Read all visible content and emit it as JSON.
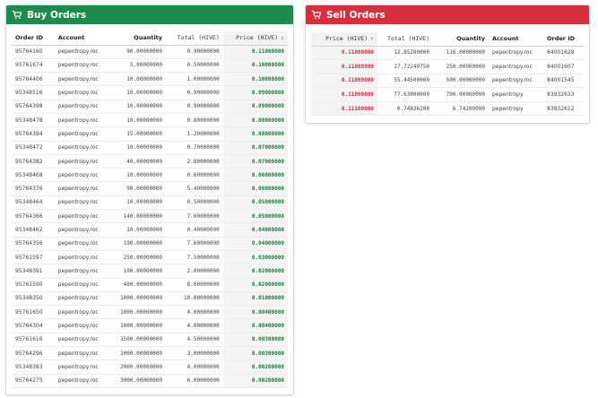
{
  "colors": {
    "buy_header": "#1e8a4c",
    "sell_header": "#d6303f",
    "buy_price": "#1e7a3c",
    "sell_price": "#d12a3a"
  },
  "buy": {
    "title": "Buy Orders",
    "icon": "cart-icon",
    "columns": {
      "order_id": "Order ID",
      "account": "Account",
      "quantity": "Quantity",
      "total": "Total (HIVE)",
      "price": "Price (HIVE)",
      "sort_indicator": "↓"
    },
    "rows": [
      {
        "order_id": "95764160",
        "account": "pepentropy.roc",
        "quantity": "90.00000000",
        "total": "9.90000000",
        "price": "0.11000000"
      },
      {
        "order_id": "95761674",
        "account": "pepentropy.roc",
        "quantity": "5.00000000",
        "total": "0.50000000",
        "price": "0.10000000"
      },
      {
        "order_id": "95764406",
        "account": "pepentropy.roc",
        "quantity": "10.00000000",
        "total": "1.00000000",
        "price": "0.10000000"
      },
      {
        "order_id": "95348516",
        "account": "pepentropy.roc",
        "quantity": "10.00000000",
        "total": "0.90000000",
        "price": "0.09000000"
      },
      {
        "order_id": "95764398",
        "account": "pepentropy.roc",
        "quantity": "10.00000000",
        "total": "0.90000000",
        "price": "0.09000000"
      },
      {
        "order_id": "95348478",
        "account": "pepentropy.roc",
        "quantity": "10.00000000",
        "total": "0.80000000",
        "price": "0.08000000"
      },
      {
        "order_id": "95764394",
        "account": "pepentropy.roc",
        "quantity": "15.00000000",
        "total": "1.20000000",
        "price": "0.08000000"
      },
      {
        "order_id": "95348472",
        "account": "pepentropy.roc",
        "quantity": "10.00000000",
        "total": "0.70000000",
        "price": "0.07000000"
      },
      {
        "order_id": "95764382",
        "account": "pepentropy.roc",
        "quantity": "40.00000000",
        "total": "2.80000000",
        "price": "0.07000000"
      },
      {
        "order_id": "95348468",
        "account": "pepentropy.roc",
        "quantity": "10.00000000",
        "total": "0.60000000",
        "price": "0.06000000"
      },
      {
        "order_id": "95764376",
        "account": "pepentropy.roc",
        "quantity": "90.00000000",
        "total": "5.40000000",
        "price": "0.06000000"
      },
      {
        "order_id": "95348464",
        "account": "pepentropy.roc",
        "quantity": "10.00000000",
        "total": "0.50000000",
        "price": "0.05000000"
      },
      {
        "order_id": "95764366",
        "account": "pepentropy.roc",
        "quantity": "140.00000000",
        "total": "7.00000000",
        "price": "0.05000000"
      },
      {
        "order_id": "95348462",
        "account": "pepentropy.roc",
        "quantity": "10.00000000",
        "total": "0.40000000",
        "price": "0.04000000"
      },
      {
        "order_id": "95764356",
        "account": "pepentropy.roc",
        "quantity": "190.00000000",
        "total": "7.60000000",
        "price": "0.04000000"
      },
      {
        "order_id": "95761597",
        "account": "pepentropy.roc",
        "quantity": "250.00000000",
        "total": "7.50000000",
        "price": "0.03000000"
      },
      {
        "order_id": "95348391",
        "account": "pepentropy.roc",
        "quantity": "100.00000000",
        "total": "2.00000000",
        "price": "0.02000000"
      },
      {
        "order_id": "95761590",
        "account": "pepentropy.roc",
        "quantity": "400.00000000",
        "total": "8.00000000",
        "price": "0.02000000"
      },
      {
        "order_id": "95348350",
        "account": "pepentropy.roc",
        "quantity": "1000.00000000",
        "total": "10.00000000",
        "price": "0.01000000"
      },
      {
        "order_id": "95761650",
        "account": "pepentropy.roc",
        "quantity": "1000.00000000",
        "total": "4.00000000",
        "price": "0.00400000"
      },
      {
        "order_id": "95764304",
        "account": "pepentropy.roc",
        "quantity": "1000.00000000",
        "total": "4.00000000",
        "price": "0.00400000"
      },
      {
        "order_id": "95761616",
        "account": "pepentropy.roc",
        "quantity": "1500.00000000",
        "total": "4.50000000",
        "price": "0.00300000"
      },
      {
        "order_id": "95764296",
        "account": "pepentropy.roc",
        "quantity": "1000.00000000",
        "total": "3.00000000",
        "price": "0.00300000"
      },
      {
        "order_id": "95348383",
        "account": "pepentropy.roc",
        "quantity": "2000.00000000",
        "total": "4.00000000",
        "price": "0.00200000"
      },
      {
        "order_id": "95764275",
        "account": "pepentropy.roc",
        "quantity": "3000.00000000",
        "total": "6.00000000",
        "price": "0.00200000"
      }
    ]
  },
  "sell": {
    "title": "Sell Orders",
    "icon": "cart-icon",
    "columns": {
      "price": "Price (HIVE)",
      "sort_indicator": "↑",
      "total": "Total (HIVE)",
      "quantity": "Quantity",
      "account": "Account",
      "order_id": "Order ID"
    },
    "rows": [
      {
        "price": "0.11080000",
        "total": "12.85280000",
        "quantity": "116.00000000",
        "account": "pepentropy.roc",
        "order_id": "84001628"
      },
      {
        "price": "0.11088999",
        "total": "27.72249750",
        "quantity": "250.00000000",
        "account": "pepentropy.roc",
        "order_id": "84001607"
      },
      {
        "price": "0.11089000",
        "total": "55.44500000",
        "quantity": "500.00000000",
        "account": "pepentropy.roc",
        "order_id": "84001545"
      },
      {
        "price": "0.11090000",
        "total": "77.63000000",
        "quantity": "700.00000000",
        "account": "pepentropy",
        "order_id": "83932633"
      },
      {
        "price": "0.11100000",
        "total": "0.74836200",
        "quantity": "6.74200000",
        "account": "pepentropy",
        "order_id": "83932612"
      }
    ]
  }
}
